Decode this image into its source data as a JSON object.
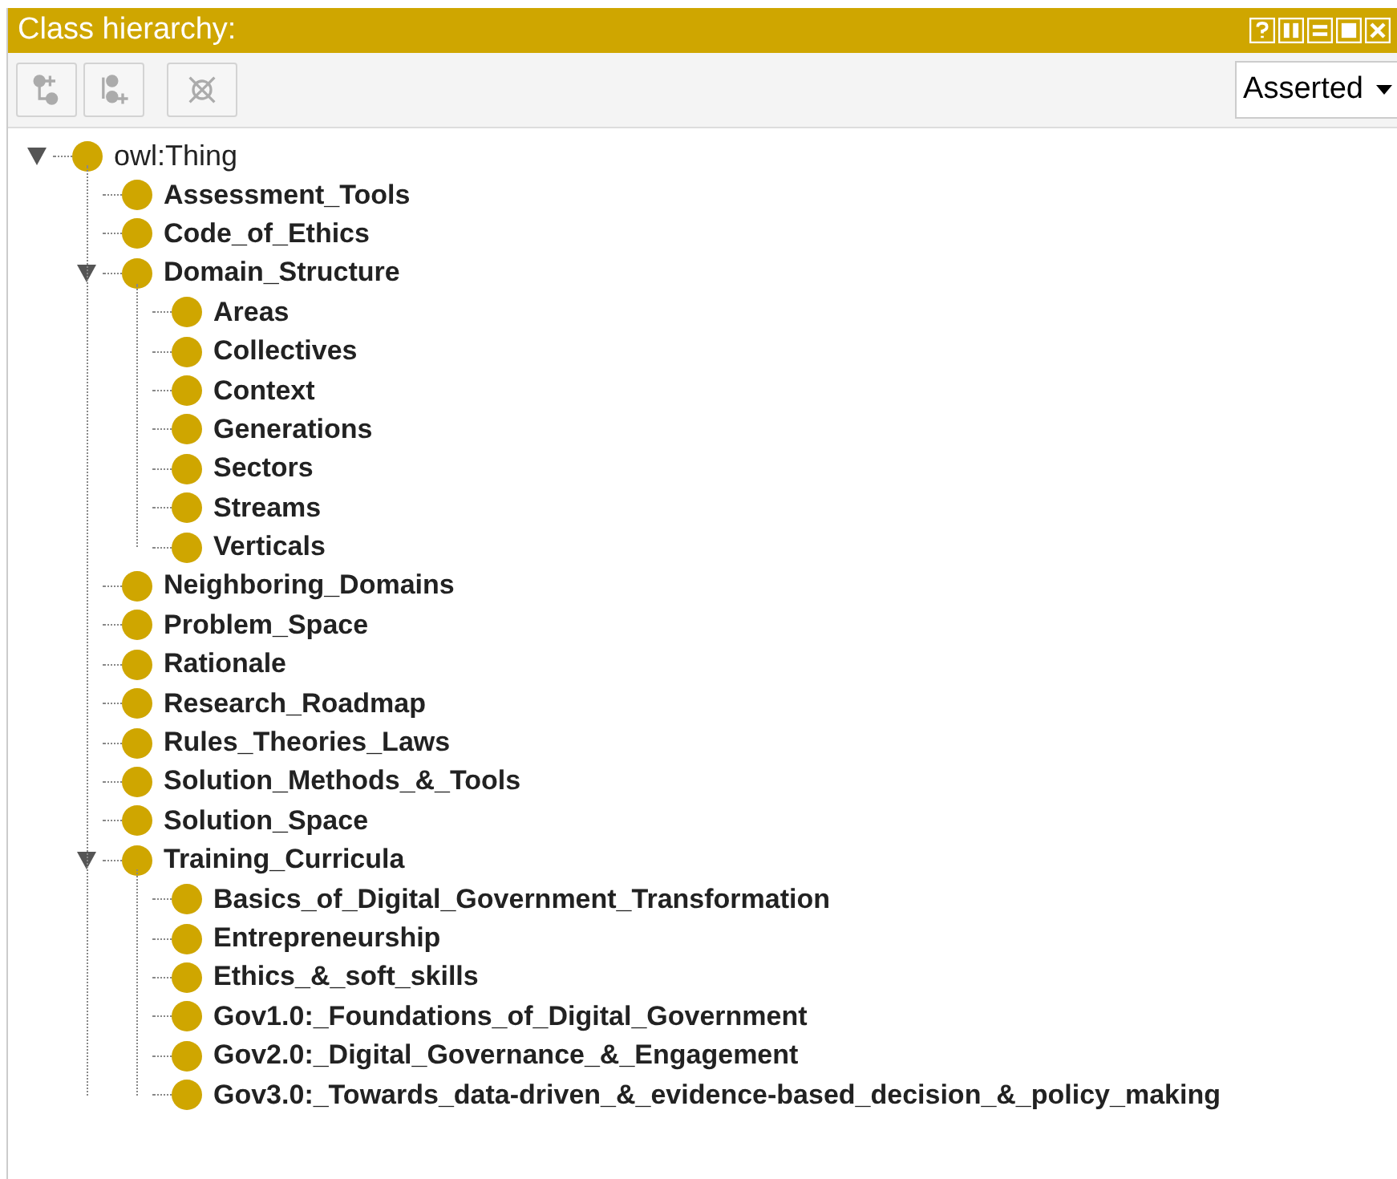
{
  "window": {
    "title": "Class hierarchy:"
  },
  "toolbar": {
    "buttons": [
      {
        "kind": "add-subclass",
        "disabled": true
      },
      {
        "kind": "add-sibling",
        "disabled": true
      },
      {
        "kind": "delete",
        "disabled": true
      }
    ],
    "view_select": {
      "value": "Asserted"
    }
  },
  "tree": [
    {
      "label": "owl:Thing",
      "expanded": true,
      "children": [
        {
          "label": "Assessment_Tools"
        },
        {
          "label": "Code_of_Ethics"
        },
        {
          "label": "Domain_Structure",
          "expanded": true,
          "children": [
            {
              "label": "Areas"
            },
            {
              "label": "Collectives"
            },
            {
              "label": "Context"
            },
            {
              "label": "Generations"
            },
            {
              "label": "Sectors"
            },
            {
              "label": "Streams"
            },
            {
              "label": "Verticals"
            }
          ]
        },
        {
          "label": "Neighboring_Domains"
        },
        {
          "label": "Problem_Space"
        },
        {
          "label": "Rationale"
        },
        {
          "label": "Research_Roadmap"
        },
        {
          "label": "Rules_Theories_Laws"
        },
        {
          "label": "Solution_Methods_&_Tools"
        },
        {
          "label": "Solution_Space"
        },
        {
          "label": "Training_Curricula",
          "expanded": true,
          "children": [
            {
              "label": "Basics_of_Digital_Government_Transformation"
            },
            {
              "label": "Entrepreneurship"
            },
            {
              "label": "Ethics_&_soft_skills"
            },
            {
              "label": "Gov1.0:_Foundations_of_Digital_Government"
            },
            {
              "label": "Gov2.0:_Digital_Governance_&_Engagement"
            },
            {
              "label": "Gov3.0:_Towards_data-driven_&_evidence-based_decision_&_policy_making"
            }
          ]
        }
      ]
    }
  ]
}
